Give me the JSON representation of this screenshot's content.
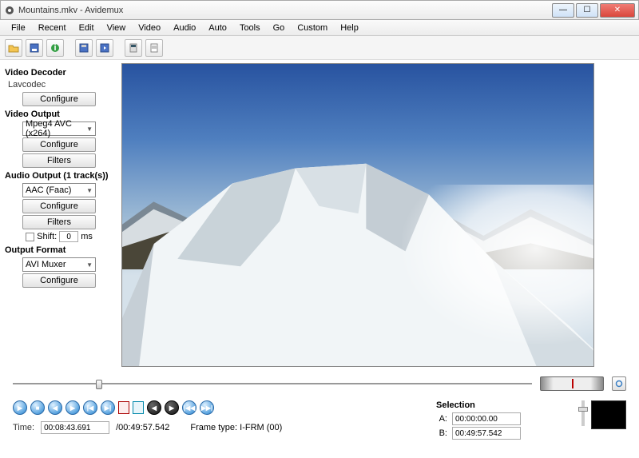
{
  "window": {
    "title": "Mountains.mkv - Avidemux"
  },
  "menu": [
    "File",
    "Recent",
    "Edit",
    "View",
    "Video",
    "Audio",
    "Auto",
    "Tools",
    "Go",
    "Custom",
    "Help"
  ],
  "toolbar_icons": [
    "open",
    "save",
    "info",
    "sep",
    "save-video",
    "save-audio",
    "sep",
    "calculator",
    "script"
  ],
  "sidebar": {
    "decoder": {
      "title": "Video Decoder",
      "codec": "Lavcodec",
      "configure": "Configure"
    },
    "video_out": {
      "title": "Video Output",
      "selected": "Mpeg4 AVC (x264)",
      "configure": "Configure",
      "filters": "Filters"
    },
    "audio_out": {
      "title": "Audio Output (1 track(s))",
      "selected": "AAC (Faac)",
      "configure": "Configure",
      "filters": "Filters",
      "shift_label": "Shift:",
      "shift_value": "0",
      "shift_unit": "ms"
    },
    "format": {
      "title": "Output Format",
      "selected": "AVI Muxer",
      "configure": "Configure"
    }
  },
  "playback": {
    "time_label": "Time:",
    "current": "00:08:43.691",
    "total": "/00:49:57.542",
    "frame_type": "Frame type: I-FRM (00)"
  },
  "selection": {
    "title": "Selection",
    "a_label": "A:",
    "a_value": "00:00:00.00",
    "b_label": "B:",
    "b_value": "00:49:57.542"
  }
}
